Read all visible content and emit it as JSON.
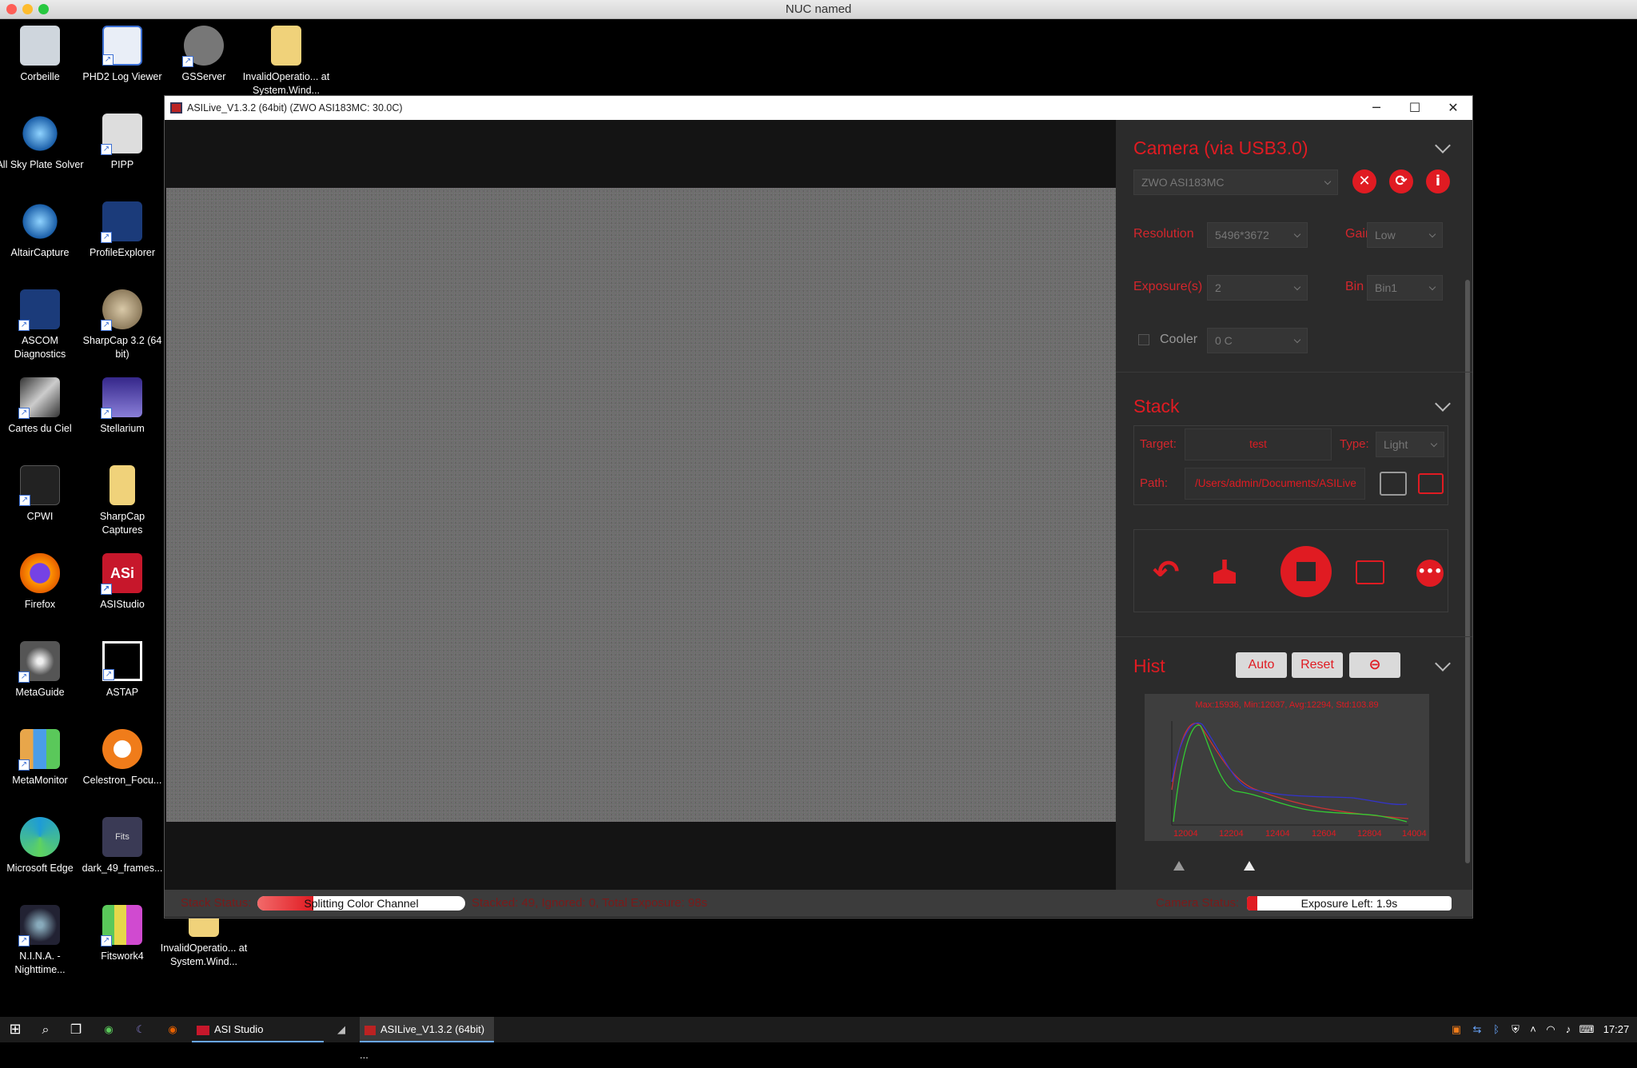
{
  "mac": {
    "title": "NUC named"
  },
  "desktop": {
    "icons": [
      {
        "label": "Corbeille",
        "color": "#cfd6dd",
        "glyph": "♻"
      },
      {
        "label": "PHD2 Log Viewer",
        "color": "#e9eef7",
        "glyph": "🔍"
      },
      {
        "label": "GSServer",
        "color": "#777",
        "glyph": "☻"
      },
      {
        "label": "InvalidOperatio... at System.Wind...",
        "color": "#f0d27a",
        "glyph": ""
      },
      {
        "label": "All Sky Plate Solver",
        "color": "#1a5ea8",
        "glyph": "✸"
      },
      {
        "label": "PIPP",
        "color": "#ddd",
        "glyph": "♄"
      },
      {
        "label": "AltairCapture",
        "color": "#1a5ea8",
        "glyph": "✸"
      },
      {
        "label": "ProfileExplorer",
        "color": "#1b3b7a",
        "glyph": "✦"
      },
      {
        "label": "ASCOM Diagnostics",
        "color": "#1b3b7a",
        "glyph": "✦"
      },
      {
        "label": "SharpCap 3.2 (64 bit)",
        "color": "#a58a5c",
        "glyph": "●"
      },
      {
        "label": "Cartes du Ciel",
        "color": "#333",
        "glyph": "☄"
      },
      {
        "label": "Stellarium",
        "color": "#35278a",
        "glyph": "☾"
      },
      {
        "label": "CPWI",
        "color": "#222",
        "glyph": "◐"
      },
      {
        "label": "SharpCap Captures",
        "color": "#f0d27a",
        "glyph": ""
      },
      {
        "label": "Firefox",
        "color": "#e66000",
        "glyph": "◉"
      },
      {
        "label": "ASIStudio",
        "color": "#c7172b",
        "glyph": "ASi"
      },
      {
        "label": "MetaGuide",
        "color": "#555",
        "glyph": "◎"
      },
      {
        "label": "ASTAP",
        "color": "#000",
        "glyph": "▣"
      },
      {
        "label": "MetaMonitor",
        "color": "#e8a64a",
        "glyph": "M"
      },
      {
        "label": "Celestron_Focu...",
        "color": "#f07c1a",
        "glyph": "◐"
      },
      {
        "label": "Microsoft Edge",
        "color": "#1e9cd6",
        "glyph": "◓"
      },
      {
        "label": "dark_49_frames...",
        "color": "#3a3a55",
        "glyph": "Fits"
      },
      {
        "label": "N.I.N.A. - Nighttime...",
        "color": "#223",
        "glyph": "◌"
      },
      {
        "label": "Fitswork4",
        "color": "#222",
        "glyph": "▪"
      },
      {
        "label": "InvalidOperatio... at System.Wind...",
        "color": "#f0d27a",
        "glyph": ""
      }
    ]
  },
  "window": {
    "title": "ASILive_V1.3.2 (64bit)  (ZWO ASI183MC: 30.0C)",
    "min": "─",
    "max": "☐",
    "close": "✕"
  },
  "camera": {
    "title": "Camera (via USB3.0)",
    "device": "ZWO ASI183MC",
    "resolution_label": "Resolution",
    "resolution": "5496*3672",
    "gain_label": "Gain",
    "gain": "Low",
    "exposure_label": "Exposure(s)",
    "exposure": "2",
    "bin_label": "Bin",
    "bin": "Bin1",
    "cooler_label": "Cooler",
    "cooler_value": "0 C"
  },
  "stack": {
    "title": "Stack",
    "target_label": "Target:",
    "target": "test",
    "type_label": "Type:",
    "type": "Light",
    "path_label": "Path:",
    "path": "/Users/admin/Documents/ASILive"
  },
  "hist": {
    "title": "Hist",
    "auto": "Auto",
    "reset": "Reset",
    "stats": "Max:15936, Min:12037, Avg:12294, Std:103.89",
    "ticks": [
      "12004",
      "12204",
      "12404",
      "12604",
      "12804",
      "14004"
    ]
  },
  "status": {
    "stack_label": "Stack Status:",
    "stack_progress": "Splitting Color Channel",
    "stack_fraction": 0.27,
    "stack_info": "Stacked: 49, Ignored: 0, Total Exposure: 98s",
    "camera_label": "Camera Status:",
    "camera_progress": "Exposure Left: 1.9s",
    "camera_fraction": 0.05
  },
  "taskbar": {
    "app1": "ASI Studio",
    "app2": "ASILive_V1.3.2 (64bit) ...",
    "clock": "17:27"
  },
  "colors": {
    "accent": "#e01b22",
    "panel": "#2b2b2b"
  }
}
